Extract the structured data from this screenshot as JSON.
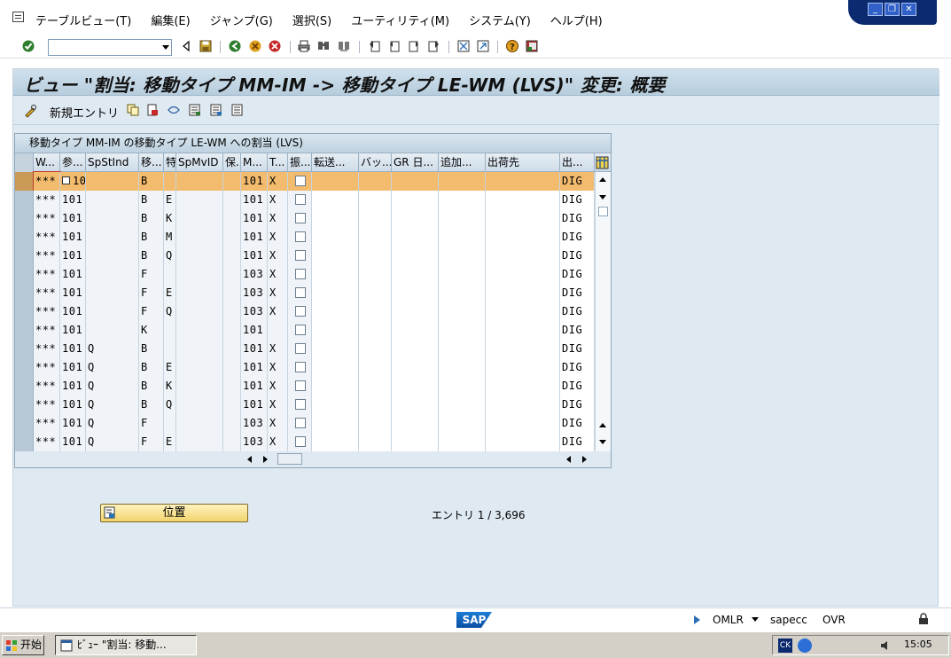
{
  "menu": {
    "items": [
      "テーブルビュー(T)",
      "編集(E)",
      "ジャンプ(G)",
      "選択(S)",
      "ユーティリティ(M)",
      "システム(Y)",
      "ヘルプ(H)"
    ]
  },
  "window_controls": {
    "minimize": "_",
    "restore": "❐",
    "close": "✕"
  },
  "command_field": {
    "value": ""
  },
  "page": {
    "title": "ビュー \"割当: 移動タイプ MM-IM -> 移動タイプ LE-WM (LVS)\" 変更: 概要"
  },
  "app_toolbar": {
    "new_entries": "新規エントリ"
  },
  "table": {
    "caption": "移動タイプ MM-IM の移動タイプ LE-WM への割当 (LVS)",
    "columns": [
      "W...",
      "参...",
      "SpStInd",
      "移...",
      "特",
      "SpMvID",
      "保...",
      "M...",
      "T...",
      "振...",
      "転送...",
      "バッ...",
      "GR 日...",
      "追加...",
      "出荷先",
      "出..."
    ],
    "rows": [
      {
        "w": "***",
        "ref": "101",
        "sp": "",
        "mv": "B",
        "sk": "",
        "spmv": "",
        "ho": "",
        "m": "101",
        "t": "X",
        "dest": "DIG"
      },
      {
        "w": "***",
        "ref": "101",
        "sp": "",
        "mv": "B",
        "sk": "E",
        "spmv": "",
        "ho": "",
        "m": "101",
        "t": "X",
        "dest": "DIG"
      },
      {
        "w": "***",
        "ref": "101",
        "sp": "",
        "mv": "B",
        "sk": "K",
        "spmv": "",
        "ho": "",
        "m": "101",
        "t": "X",
        "dest": "DIG"
      },
      {
        "w": "***",
        "ref": "101",
        "sp": "",
        "mv": "B",
        "sk": "M",
        "spmv": "",
        "ho": "",
        "m": "101",
        "t": "X",
        "dest": "DIG"
      },
      {
        "w": "***",
        "ref": "101",
        "sp": "",
        "mv": "B",
        "sk": "Q",
        "spmv": "",
        "ho": "",
        "m": "101",
        "t": "X",
        "dest": "DIG"
      },
      {
        "w": "***",
        "ref": "101",
        "sp": "",
        "mv": "F",
        "sk": "",
        "spmv": "",
        "ho": "",
        "m": "103",
        "t": "X",
        "dest": "DIG"
      },
      {
        "w": "***",
        "ref": "101",
        "sp": "",
        "mv": "F",
        "sk": "E",
        "spmv": "",
        "ho": "",
        "m": "103",
        "t": "X",
        "dest": "DIG"
      },
      {
        "w": "***",
        "ref": "101",
        "sp": "",
        "mv": "F",
        "sk": "Q",
        "spmv": "",
        "ho": "",
        "m": "103",
        "t": "X",
        "dest": "DIG"
      },
      {
        "w": "***",
        "ref": "101",
        "sp": "",
        "mv": "K",
        "sk": "",
        "spmv": "",
        "ho": "",
        "m": "101",
        "t": "",
        "dest": "DIG"
      },
      {
        "w": "***",
        "ref": "101",
        "sp": "Q",
        "mv": "B",
        "sk": "",
        "spmv": "",
        "ho": "",
        "m": "101",
        "t": "X",
        "dest": "DIG"
      },
      {
        "w": "***",
        "ref": "101",
        "sp": "Q",
        "mv": "B",
        "sk": "E",
        "spmv": "",
        "ho": "",
        "m": "101",
        "t": "X",
        "dest": "DIG"
      },
      {
        "w": "***",
        "ref": "101",
        "sp": "Q",
        "mv": "B",
        "sk": "K",
        "spmv": "",
        "ho": "",
        "m": "101",
        "t": "X",
        "dest": "DIG"
      },
      {
        "w": "***",
        "ref": "101",
        "sp": "Q",
        "mv": "B",
        "sk": "Q",
        "spmv": "",
        "ho": "",
        "m": "101",
        "t": "X",
        "dest": "DIG"
      },
      {
        "w": "***",
        "ref": "101",
        "sp": "Q",
        "mv": "F",
        "sk": "",
        "spmv": "",
        "ho": "",
        "m": "103",
        "t": "X",
        "dest": "DIG"
      },
      {
        "w": "***",
        "ref": "101",
        "sp": "Q",
        "mv": "F",
        "sk": "E",
        "spmv": "",
        "ho": "",
        "m": "103",
        "t": "X",
        "dest": "DIG"
      }
    ]
  },
  "position_button": {
    "label": "位置"
  },
  "entry_status": "エントリ 1 / 3,696",
  "status_bar": {
    "transaction": "OMLR",
    "server": "sapecc",
    "mode": "OVR",
    "logo": "SAP"
  },
  "taskbar": {
    "start": "开始",
    "task": "ﾋﾞｭｰ \"割当: 移動...",
    "clock": "15:05"
  },
  "colors": {
    "active_row": "#f3bb6d",
    "title_bg": "#c3d6e4",
    "panel_bg": "#dfe9f1",
    "button_yellow": "#f1d46d"
  }
}
